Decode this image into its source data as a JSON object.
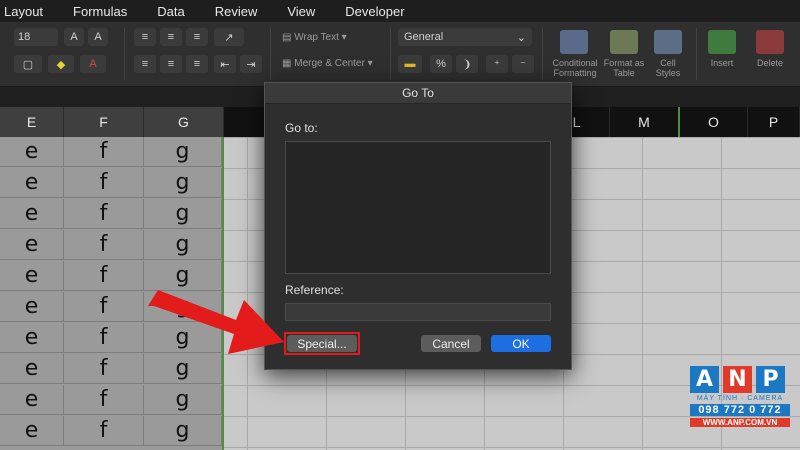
{
  "menubar": {
    "items": [
      "Layout",
      "Formulas",
      "Data",
      "Review",
      "View",
      "Developer"
    ]
  },
  "ribbon": {
    "font_size": "18",
    "wrap_text": "Wrap Text",
    "merge_center": "Merge & Center",
    "number_format": "General",
    "conditional_formatting": "Conditional Formatting",
    "format_as_table": "Format as Table",
    "cell_styles": "Cell Styles",
    "insert": "Insert",
    "delete": "Delete",
    "percent": "%"
  },
  "columns": [
    "E",
    "F",
    "G",
    "",
    "",
    "",
    "",
    "L",
    "M",
    "O",
    "P"
  ],
  "cells": {
    "e": [
      "e",
      "e",
      "e",
      "e",
      "e",
      "e",
      "e",
      "e",
      "e",
      "e"
    ],
    "f": [
      "f",
      "f",
      "f",
      "f",
      "f",
      "f",
      "f",
      "f",
      "f",
      "f"
    ],
    "g": [
      "g",
      "g",
      "g",
      "g",
      "g",
      "g",
      "g",
      "g",
      "g",
      "g"
    ]
  },
  "dialog": {
    "title": "Go To",
    "goto_label": "Go to:",
    "reference_label": "Reference:",
    "reference_value": "",
    "special_label": "Special...",
    "cancel_label": "Cancel",
    "ok_label": "OK"
  },
  "watermark": {
    "letters": [
      "A",
      "N",
      "P"
    ],
    "tagline": "MÁY TÍNH · CAMERA",
    "phone": "098 772 0 772",
    "site": "WWW.ANP.COM.VN"
  },
  "colors": {
    "accent_blue": "#1d6ee0",
    "highlight_red": "#e31b1b",
    "selection_green": "#4f8f3f"
  }
}
